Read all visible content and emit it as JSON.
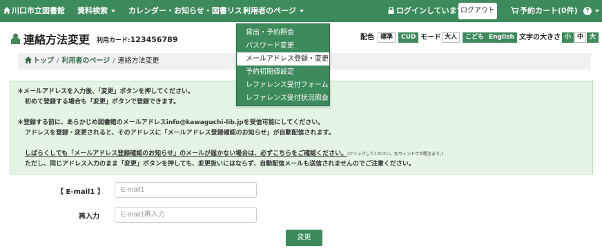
{
  "navbar": {
    "library_name": "川口市立図書館",
    "menu_search": "資料検索",
    "menu_calendar": "カレンダー・お知らせ・図書リスト",
    "menu_user": "利用者のページ",
    "login_status": "ログインしています",
    "logout": "ログアウト",
    "cart": "予約カート(0件)",
    "help": "?"
  },
  "page": {
    "title": "連絡方法変更",
    "card_label": "利用カード:",
    "card_number": "123456789"
  },
  "accessibility": {
    "color_label": "配色",
    "color_standard": "標準",
    "color_cud": "CUD",
    "mode_label": "モード",
    "mode_adult": "大人",
    "mode_kids": "こども",
    "mode_english": "English",
    "font_label": "文字の大きさ",
    "font_small": "小",
    "font_medium": "中",
    "font_large": "大"
  },
  "breadcrumb": {
    "top": "トップ",
    "user_page": "利用者のページ",
    "current": "連絡方法変更",
    "separator": "/"
  },
  "dropdown": {
    "items": [
      "貸出・予約照会",
      "パスワード変更",
      "メールアドレス登録・変更",
      "予約初期値設定",
      "レファレンス受付フォーム",
      "レファレンス受付状況照会"
    ]
  },
  "notice": {
    "line1": "＊メールアドレスを入力後、「変更」ボタンを押してください。",
    "line2": "初めて登録する場合も「変更」ボタンで登録できます。",
    "line3": "＊登録する前に、あらかじめ図書館のメールアドレスinfo@kawaguchi-lib.jpを受信可能にしてください。",
    "line4": "アドレスを登録・変更されると、そのアドレスに「メールアドレス登録確認のお知らせ」が自動配信されます。",
    "line5": "しばらくしても「メールアドレス登録確認のお知らせ」のメールが届かない場合は、必ずこちらをご確認ください。",
    "line5_small": "(クリックしてください。別ウィンドウが開きます。)",
    "line6": "ただし、同じアドレス入力のまま「変更」ボタンを押しても、変更扱いにはならず、自動配信メールも送信されませんのでご注意ください。"
  },
  "form": {
    "email_label": "【 E-mail1 】",
    "email_placeholder": "E-mail1",
    "reenter_label": "再入力",
    "reenter_placeholder": "E-mail1再入力",
    "submit": "変更"
  },
  "colors": {
    "brand": "#3d8a5c",
    "notice_bg": "#e4f5e4",
    "breadcrumb_bg": "#f1f1f1"
  }
}
